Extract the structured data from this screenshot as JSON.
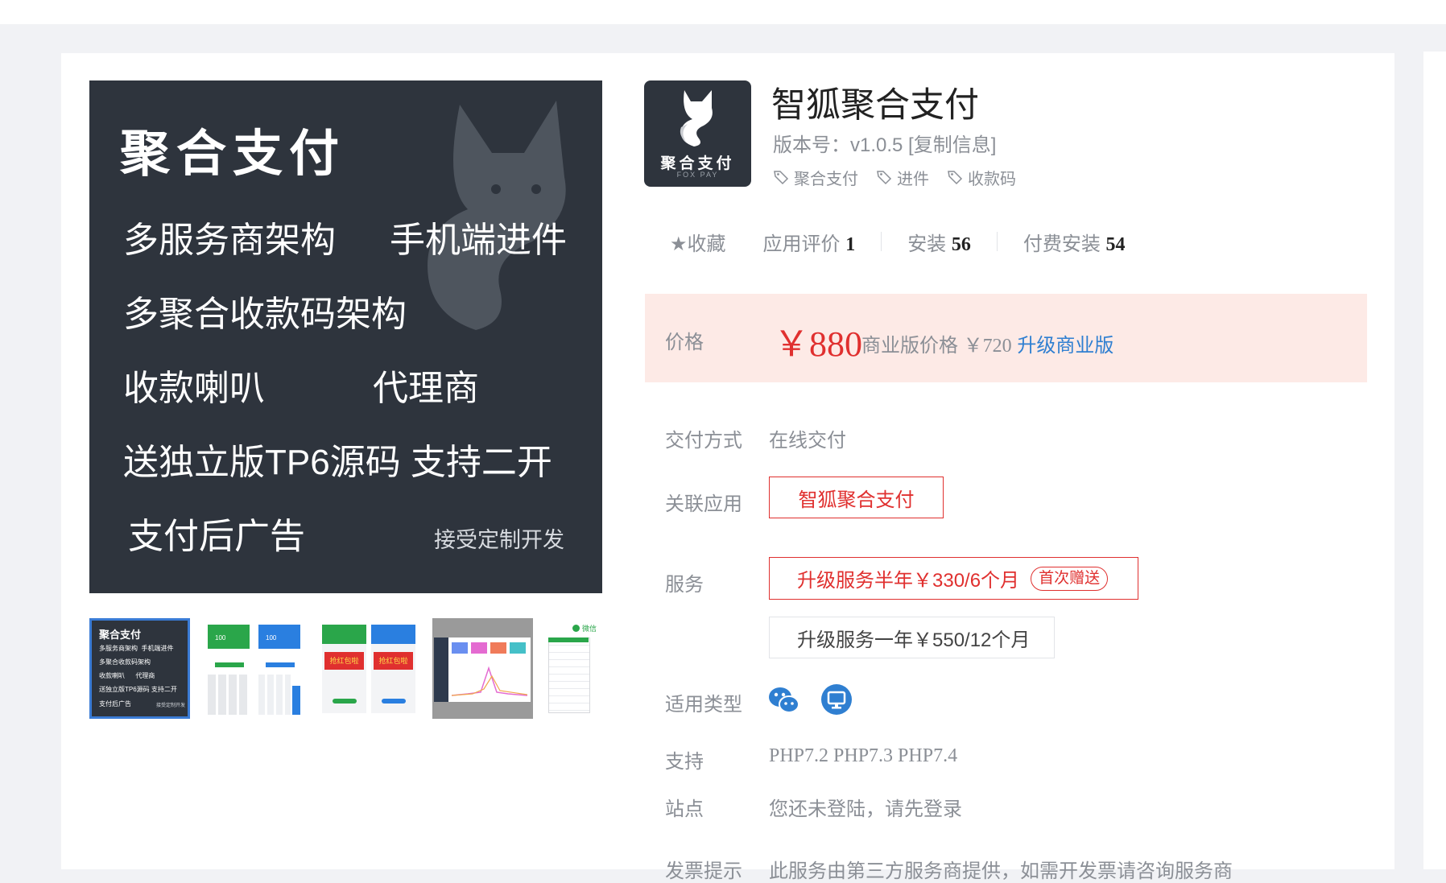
{
  "main_image": {
    "title": "聚合支付",
    "lines": [
      "多服务商架构",
      "手机端进件",
      "多聚合收款码架构",
      "收款喇叭",
      "代理商",
      "送独立版TP6源码 支持二开",
      "支付后广告"
    ],
    "small": "接受定制开发"
  },
  "thumbnails": [
    {
      "title": "聚合支付",
      "lines": [
        "多服务商架构  手机端进件",
        "多聚合收款码架构",
        "收款喇叭      代理商",
        "送独立版TP6源码 支持二开",
        "支付后广告"
      ],
      "small": "接受定制开发",
      "selected": true
    },
    {
      "amount1": "100",
      "amount2": "100"
    },
    {
      "banner1": "抢红包啦",
      "banner2": "抢红包啦"
    },
    {},
    {
      "label": "微信"
    }
  ],
  "logo": {
    "text": "聚合支付",
    "sub": "FOX PAY"
  },
  "app": {
    "title": "智狐聚合支付",
    "version": "版本号：v1.0.5 [复制信息]",
    "tags": [
      "聚合支付",
      "进件",
      "收款码"
    ]
  },
  "stats": {
    "favorite": "★收藏",
    "rating_label": "应用评价",
    "rating_value": "1",
    "install_label": "安装",
    "install_value": "56",
    "paid_label": "付费安装",
    "paid_value": "54"
  },
  "price": {
    "label": "价格",
    "amount": "￥880",
    "commercial_label": "商业版价格",
    "commercial_amount": "￥720",
    "upgrade_link": "升级商业版"
  },
  "delivery": {
    "label": "交付方式",
    "value": "在线交付"
  },
  "related": {
    "label": "关联应用",
    "value": "智狐聚合支付"
  },
  "service": {
    "label": "服务",
    "option1": "升级服务半年￥330/6个月",
    "option1_badge": "首次赠送",
    "option2": "升级服务一年￥550/12个月"
  },
  "types": {
    "label": "适用类型",
    "icons": [
      "wechat-icon",
      "pc-icon"
    ]
  },
  "support": {
    "label": "支持",
    "value": "PHP7.2 PHP7.3 PHP7.4"
  },
  "site": {
    "label": "站点",
    "value": "您还未登陆，请先登录"
  },
  "invoice": {
    "label": "发票提示",
    "value": "此服务由第三方服务商提供，如需开发票请咨询服务商"
  },
  "colors": {
    "accent_red": "#e0302f",
    "link_blue": "#2f7fd1",
    "price_bg": "#fdeae6",
    "dark_bg": "#2e343d"
  }
}
